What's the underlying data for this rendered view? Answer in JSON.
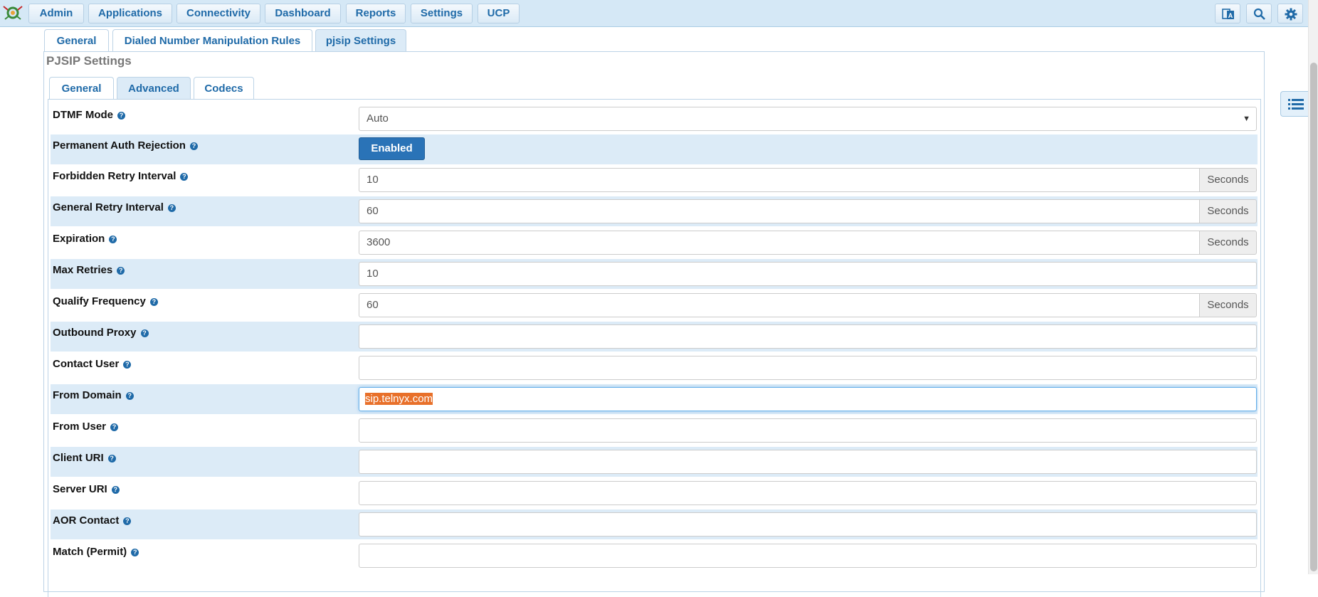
{
  "nav": {
    "menu": [
      "Admin",
      "Applications",
      "Connectivity",
      "Dashboard",
      "Reports",
      "Settings",
      "UCP"
    ],
    "icons": [
      "language-icon",
      "search-icon",
      "gear-icon"
    ]
  },
  "tabs": {
    "outer": [
      "General",
      "Dialed Number Manipulation Rules",
      "pjsip Settings"
    ],
    "outer_active": "pjsip Settings",
    "inner": [
      "General",
      "Advanced",
      "Codecs"
    ],
    "inner_active": "Advanced"
  },
  "section_title": "PJSIP Settings",
  "help_glyph": "?",
  "seconds_label": "Seconds",
  "fields": {
    "dtmf_mode": {
      "label": "DTMF Mode",
      "value": "Auto"
    },
    "permanent_auth_rejection": {
      "label": "Permanent Auth Rejection",
      "value": "Enabled"
    },
    "forbidden_retry_interval": {
      "label": "Forbidden Retry Interval",
      "value": "10"
    },
    "general_retry_interval": {
      "label": "General Retry Interval",
      "value": "60"
    },
    "expiration": {
      "label": "Expiration",
      "value": "3600"
    },
    "max_retries": {
      "label": "Max Retries",
      "value": "10"
    },
    "qualify_frequency": {
      "label": "Qualify Frequency",
      "value": "60"
    },
    "outbound_proxy": {
      "label": "Outbound Proxy",
      "value": ""
    },
    "contact_user": {
      "label": "Contact User",
      "value": ""
    },
    "from_domain": {
      "label": "From Domain",
      "value": "sip.telnyx.com"
    },
    "from_user": {
      "label": "From User",
      "value": ""
    },
    "client_uri": {
      "label": "Client URI",
      "value": ""
    },
    "server_uri": {
      "label": "Server URI",
      "value": ""
    },
    "aor_contact": {
      "label": "AOR Contact",
      "value": ""
    },
    "match_permit": {
      "label": "Match (Permit)",
      "value": ""
    }
  },
  "colors": {
    "navbar_bg": "#d5e8f6",
    "accent": "#1f6aa8",
    "row_shade": "#dcebf7",
    "toggle_on": "#2a73b7",
    "selection": "#e8702a"
  }
}
